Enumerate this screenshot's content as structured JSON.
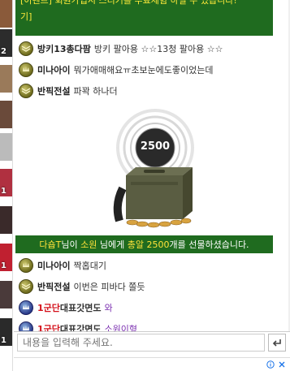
{
  "notice": {
    "line1": "[이벤트] 회원가입시 스티커를 무료체험 하실 수 있습니다!",
    "line2": "기]"
  },
  "left_strip": {
    "badges": [
      "2",
      "1",
      "1",
      "1"
    ]
  },
  "messages_top": [
    {
      "nick": "방키13총다팜",
      "text": "방키 팔아용 ☆☆13청 팔아용 ☆☆"
    },
    {
      "nick": "미나아이",
      "text": "뭐가애매해요ㅠ초보눈에도좋이었는데"
    },
    {
      "nick": "반픽전설",
      "text": "파꽉 하나더"
    }
  ],
  "gift": {
    "count": "2500",
    "banner_sender": "다숍T",
    "banner_mid1": "님이 ",
    "banner_receiver": "소원",
    "banner_mid2": " 님에게 ",
    "banner_item": "총알 2500",
    "banner_tail": "개를 선물하셨습니다."
  },
  "messages_bottom": [
    {
      "nick": "미나아이",
      "text": "짝홉대기"
    },
    {
      "nick": "반픽전설",
      "text": "이번은 피바다 쫄듯"
    },
    {
      "nick_red": "1군단",
      "nick_sub": "대표갓면도",
      "text": "와"
    },
    {
      "nick_red": "1군단",
      "nick_sub": "대표갓면도",
      "text": "소원이형"
    }
  ],
  "input": {
    "placeholder": "내용을 입력해 주세요."
  },
  "colors": {
    "notice_bg": "#1f6b1f",
    "notice_text": "#ffea3a",
    "red_nick": "#d4101a",
    "chat_purple": "#7b2fb0"
  },
  "icons": {
    "send": "enter-arrow-icon",
    "ad_info": "info-icon",
    "ad_close": "close-icon"
  }
}
